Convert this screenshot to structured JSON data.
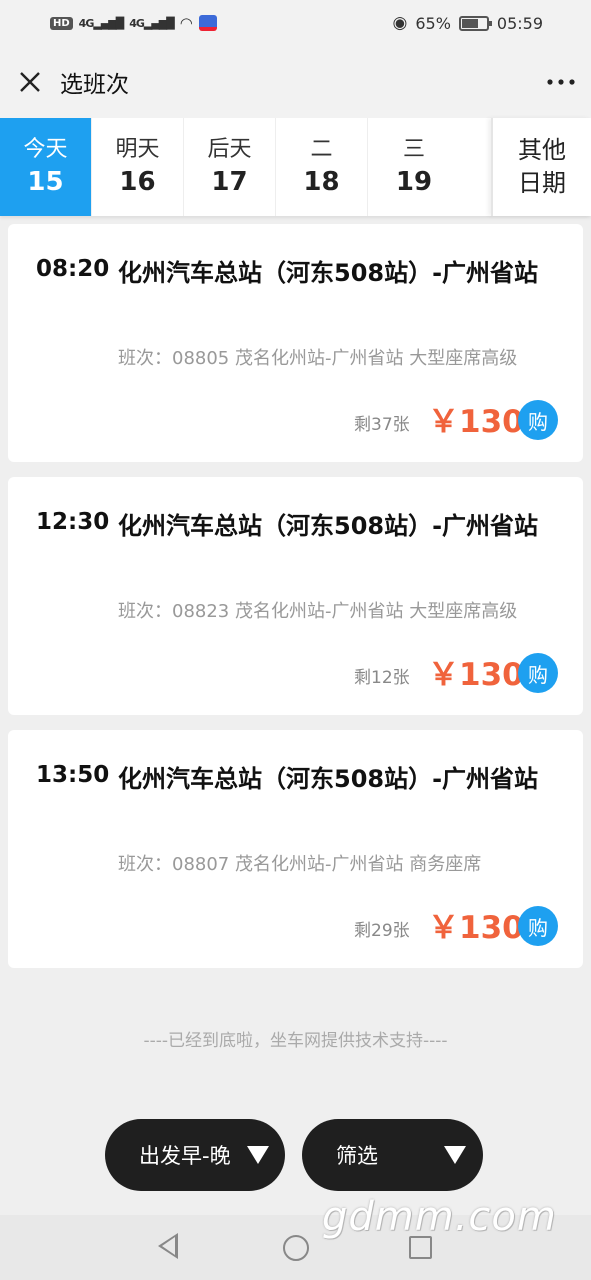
{
  "status_bar": {
    "hd_badge": "HD",
    "signal_1": "4G",
    "signal_2": "4G",
    "battery_percent": "65%",
    "time": "05:59"
  },
  "header": {
    "title": "选班次"
  },
  "dates": {
    "tabs": [
      {
        "name": "今天",
        "day": "15",
        "active": true
      },
      {
        "name": "明天",
        "day": "16",
        "active": false
      },
      {
        "name": "后天",
        "day": "17",
        "active": false
      },
      {
        "name": "二",
        "day": "18",
        "active": false
      },
      {
        "name": "三",
        "day": "19",
        "active": false
      }
    ],
    "other_line1": "其他",
    "other_line2": "日期"
  },
  "trips": [
    {
      "time": "08:20",
      "route": "化州汽车总站（河东508站）-广州省站",
      "info": "班次：08805 茂名化州站-广州省站 大型座席高级",
      "remaining": "剩37张",
      "price": "￥130",
      "buy_label": "购"
    },
    {
      "time": "12:30",
      "route": "化州汽车总站（河东508站）-广州省站",
      "info": "班次：08823 茂名化州站-广州省站 大型座席高级",
      "remaining": "剩12张",
      "price": "￥130",
      "buy_label": "购"
    },
    {
      "time": "13:50",
      "route": "化州汽车总站（河东508站）-广州省站",
      "info": "班次：08807 茂名化州站-广州省站 商务座席",
      "remaining": "剩29张",
      "price": "￥130",
      "buy_label": "购"
    }
  ],
  "footer_note": "----已经到底啦，坐车网提供技术支持----",
  "filters": {
    "sort_label": "出发早-晚",
    "filter_label": "筛选"
  },
  "watermark": "gdmm.com",
  "colors": {
    "accent": "#1ea0f0",
    "price": "#f0633c",
    "pill_bg": "#1f1f1f"
  }
}
